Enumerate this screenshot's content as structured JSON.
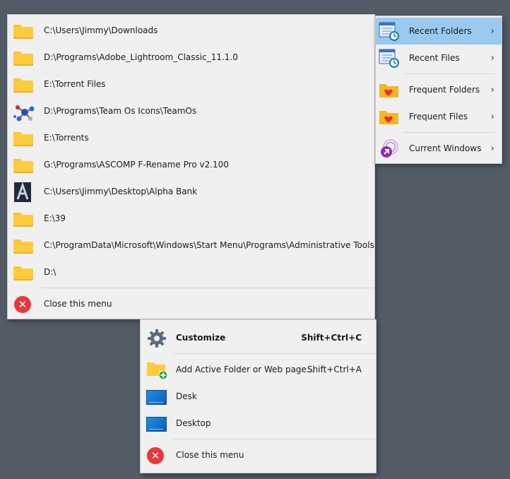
{
  "recent_menu": {
    "items": [
      {
        "label": "C:\\Users\\Jimmy\\Downloads",
        "icon": "folder-icon"
      },
      {
        "label": "D:\\Programs\\Adobe_Lightroom_Classic_11.1.0",
        "icon": "folder-icon"
      },
      {
        "label": "E:\\Torrent Files",
        "icon": "folder-icon"
      },
      {
        "label": "D:\\Programs\\Team Os Icons\\TeamOs",
        "icon": "molecule-icon"
      },
      {
        "label": "E:\\Torrents",
        "icon": "folder-icon"
      },
      {
        "label": "G:\\Programs\\ASCOMP F-Rename Pro v2.100",
        "icon": "folder-icon"
      },
      {
        "label": "C:\\Users\\Jimmy\\Desktop\\Alpha Bank",
        "icon": "alpha-bank-icon"
      },
      {
        "label": "E:\\39",
        "icon": "folder-icon"
      },
      {
        "label": "C:\\ProgramData\\Microsoft\\Windows\\Start Menu\\Programs\\Administrative Tools",
        "icon": "folder-icon"
      },
      {
        "label": "D:\\",
        "icon": "folder-icon"
      }
    ],
    "close_label": "Close this menu"
  },
  "sub_menu": {
    "items": [
      {
        "label": "Recent Folders",
        "icon": "recent-folders-icon",
        "selected": true
      },
      {
        "label": "Recent Files",
        "icon": "recent-files-icon"
      },
      {
        "label": "Frequent Folders",
        "icon": "heart-folder-icon"
      },
      {
        "label": "Frequent Files",
        "icon": "heart-folder-icon"
      },
      {
        "label": "Current Windows",
        "icon": "current-windows-icon"
      }
    ],
    "chevron": "›",
    "selected_color": "#99c9ef"
  },
  "bottom_menu": {
    "customize_label": "Customize",
    "customize_shortcut": "Shift+Ctrl+C",
    "add_label": "Add Active Folder or Web page...",
    "add_shortcut": "Shift+Ctrl+A",
    "desk_label": "Desk",
    "desktop_label": "Desktop",
    "close_label": "Close this menu"
  },
  "colors": {
    "background": "#535b67",
    "menu": "#f0f0f0",
    "folder": "#fecb3d",
    "close": "#e8373b"
  }
}
